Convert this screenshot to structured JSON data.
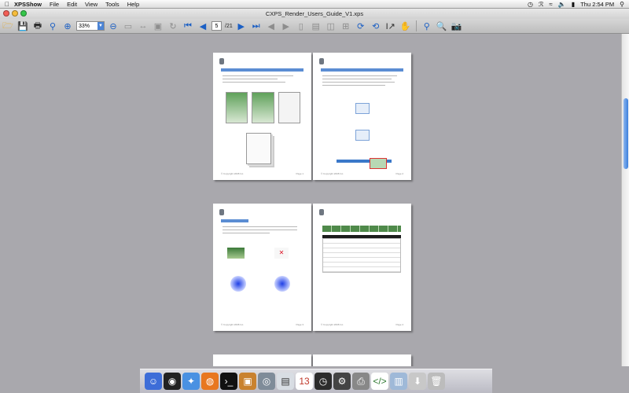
{
  "menubar": {
    "app": "XPSShow",
    "items": [
      "File",
      "Edit",
      "View",
      "Tools",
      "Help"
    ],
    "clock": "Thu 2:54 PM"
  },
  "window": {
    "title": "CXPS_Render_Users_Guide_V1.xps"
  },
  "toolbar": {
    "zoom": "33%",
    "page_current": "5",
    "page_total": "/21"
  },
  "pages": [
    {
      "footer_left": "© Copyright 2008 Inc.",
      "footer_right": "Page 1"
    },
    {
      "footer_left": "© Copyright 2008 Inc.",
      "footer_right": "Page 2"
    },
    {
      "footer_left": "© Copyright 2008 Inc.",
      "footer_right": "Page 3"
    },
    {
      "footer_left": "© Copyright 2008 Inc.",
      "footer_right": "Page 4"
    }
  ],
  "colors": {
    "accent": "#5b8dd3",
    "background": "#a9a8ad"
  }
}
